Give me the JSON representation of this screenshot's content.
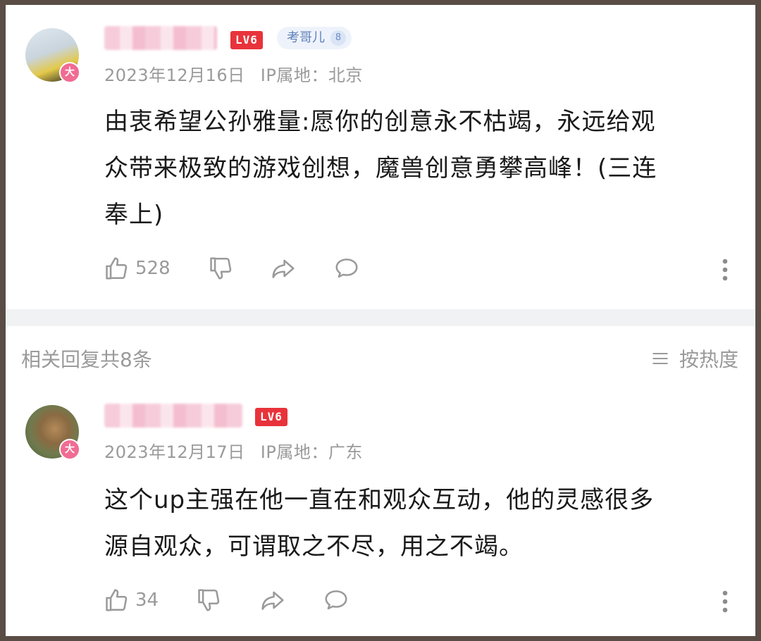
{
  "comment1": {
    "level": "LV6",
    "fan_badge": {
      "label": "考哥儿",
      "level": "8"
    },
    "avatar_badge": "大",
    "date": "2023年12月16日",
    "ip": "IP属地：北京",
    "content_lines": [
      "由衷希望公孙雅量:愿你的创意永不枯竭，永远给观",
      "众带来极致的游戏创想，魔兽创意勇攀高峰！(三连",
      "奉上)"
    ],
    "likes": "528"
  },
  "replies_header": {
    "count_label": "相关回复共8条",
    "sort_label": "按热度"
  },
  "comment2": {
    "level": "LV6",
    "avatar_badge": "大",
    "date": "2023年12月17日",
    "ip": "IP属地：广东",
    "content_lines": [
      "这个up主强在他一直在和观众互动，他的灵感很多",
      "源自观众，可谓取之不尽，用之不竭。"
    ],
    "likes": "34"
  },
  "colors": {
    "level_badge": "#e8333b",
    "avatar_badge": "#f06c93",
    "fan_badge_text": "#5d7fb8",
    "meta_text": "#9a9a9a"
  },
  "icons": [
    "thumbs-up-icon",
    "thumbs-down-icon",
    "share-icon",
    "comment-icon",
    "more-vertical-icon",
    "sort-lines-icon"
  ]
}
